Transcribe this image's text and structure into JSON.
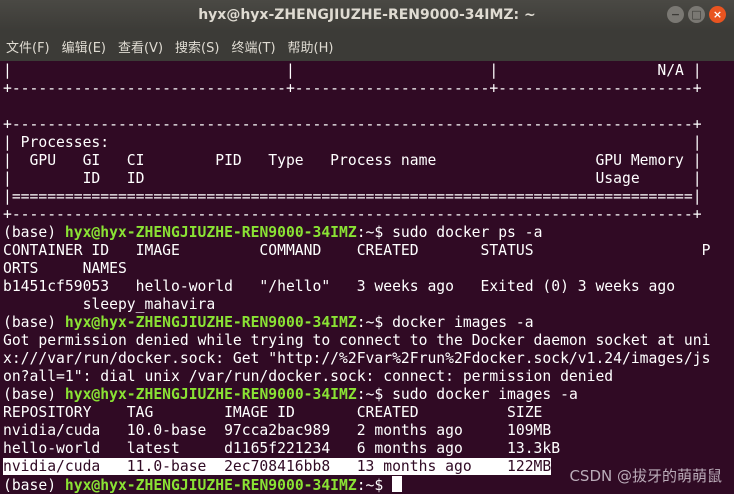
{
  "window": {
    "title": "hyx@hyx-ZHENGJIUZHE-REN9000-34IMZ: ~",
    "buttons": {
      "minimize": "−",
      "maximize": "□",
      "close": "×"
    }
  },
  "menu": [
    "文件(F)",
    "编辑(E)",
    "查看(V)",
    "搜索(S)",
    "终端(T)",
    "帮助(H)"
  ],
  "prompt": {
    "base": "(base) ",
    "user": "hyx@hyx-ZHENGJIUZHE-REN9000-34IMZ",
    "sep": ":~$ "
  },
  "terminal": {
    "nvsmi": [
      "|                               |                      |                  N/A |",
      "+-------------------------------+----------------------+----------------------+",
      "",
      "+-----------------------------------------------------------------------------+",
      "| Processes:                                                                  |",
      "|  GPU   GI   CI        PID   Type   Process name                  GPU Memory |",
      "|        ID   ID                                                   Usage      |",
      "|=============================================================================|",
      "+-----------------------------------------------------------------------------+"
    ],
    "cmd1": "sudo docker ps -a",
    "ps_out": [
      "CONTAINER ID   IMAGE         COMMAND    CREATED       STATUS                   P",
      "ORTS     NAMES",
      "b1451cf59053   hello-world   \"/hello\"   3 weeks ago   Exited (0) 3 weeks ago",
      "         sleepy_mahavira"
    ],
    "cmd2": "docker images -a",
    "images_err": [
      "Got permission denied while trying to connect to the Docker daemon socket at uni",
      "x:///var/run/docker.sock: Get \"http://%2Fvar%2Frun%2Fdocker.sock/v1.24/images/js",
      "on?all=1\": dial unix /var/run/docker.sock: connect: permission denied"
    ],
    "cmd3": "sudo docker images -a",
    "images_header": "REPOSITORY    TAG        IMAGE ID       CREATED          SIZE",
    "images_rows": [
      "nvidia/cuda   10.0-base  97cca2bac989   2 months ago     109MB",
      "hello-world   latest     d1165f221234   6 months ago     13.3kB",
      "nvidia/cuda   11.0-base  2ec708416bb8   13 months ago    122MB"
    ]
  },
  "watermark": "CSDN @拔牙的萌萌鼠",
  "colors": {
    "background": "#300a24",
    "prompt_green": "#8ae234",
    "titlebar": "#3c3b37",
    "close_button": "#e95420"
  }
}
